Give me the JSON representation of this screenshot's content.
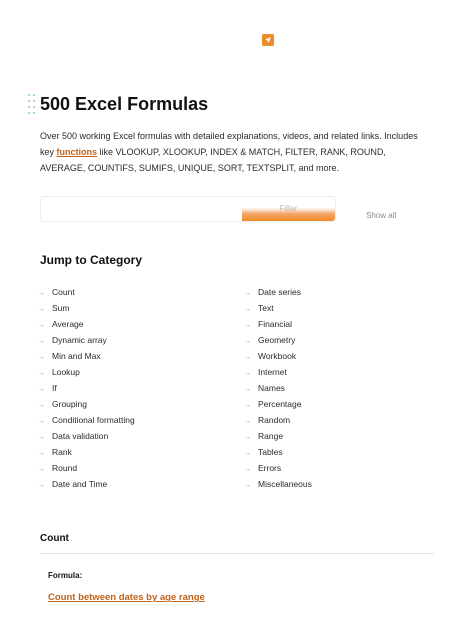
{
  "header": {
    "logo_icon": "paper-plane-icon",
    "brand_color": "#f08a24"
  },
  "page": {
    "title": "500 Excel Formulas",
    "intro_before": "Over 500 working Excel formulas with detailed explanations, videos, and related links. Includes key ",
    "intro_link": "functions",
    "intro_after": " like VLOOKUP, XLOOKUP, INDEX & MATCH, FILTER, RANK, ROUND, AVERAGE, COUNTIFS, SUMIFS, UNIQUE, SORT, TEXTSPLIT, and more."
  },
  "filter": {
    "input_value": "",
    "button_label": "Filter",
    "show_all_label": "Show all"
  },
  "jump": {
    "title": "Jump to Category",
    "left": [
      "Count",
      "Sum",
      "Average",
      "Dynamic array",
      "Min and Max",
      "Lookup",
      "If",
      "Grouping",
      "Conditional formatting",
      "Data validation",
      "Rank",
      "Round",
      "Date and Time"
    ],
    "right": [
      "Date series",
      "Text",
      "Financial",
      "Geometry",
      "Workbook",
      "Internet",
      "Names",
      "Percentage",
      "Random",
      "Range",
      "Tables",
      "Errors",
      "Miscellaneous"
    ]
  },
  "section": {
    "title": "Count",
    "formula_label": "Formula:",
    "first_formula": "Count between dates by age range"
  },
  "colors": {
    "accent": "#c0621a",
    "arrow": "#29b6c8"
  }
}
